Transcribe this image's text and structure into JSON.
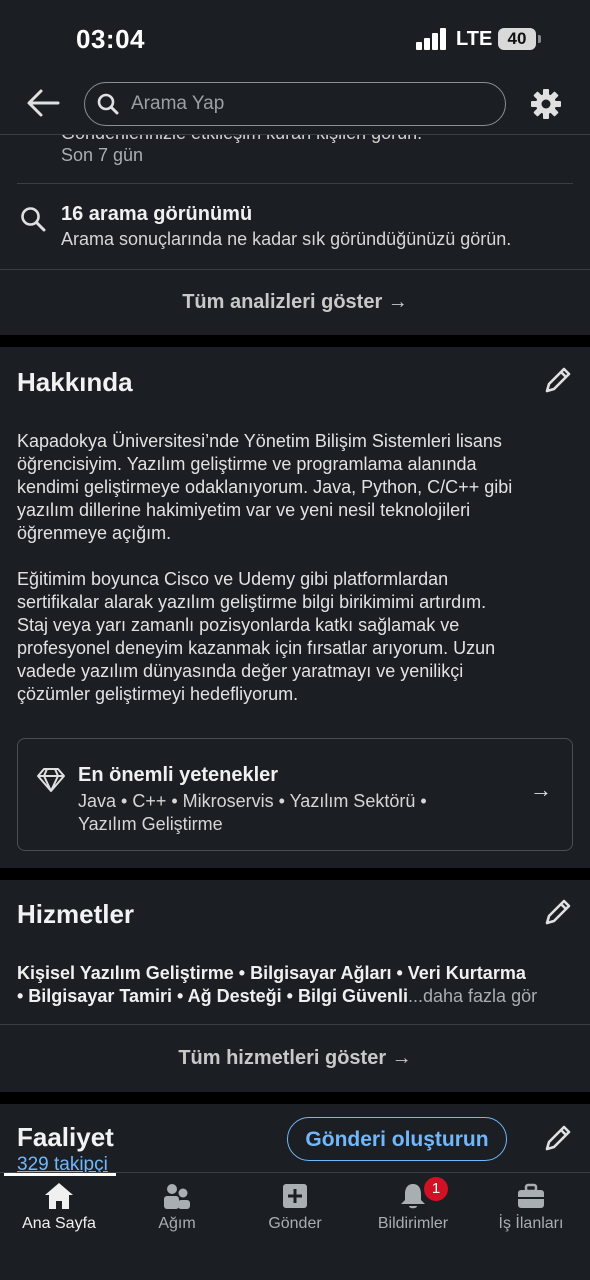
{
  "status_bar": {
    "time": "03:04",
    "network": "LTE",
    "battery": "40"
  },
  "top_bar": {
    "search_placeholder": "Arama Yap"
  },
  "analytics": {
    "partial_text": "Gönderilerinizle etkileşim kuran kişileri görün.",
    "period": "Son 7 gün",
    "search_appearances_title": "16 arama görünümü",
    "search_appearances_desc": "Arama sonuçlarında ne kadar sık göründüğünüzü görün.",
    "show_all": "Tüm analizleri göster →"
  },
  "about": {
    "title": "Hakkında",
    "paragraph1_lines": [
      "Kapadokya Üniversitesi’nde Yönetim Bilişim Sistemleri lisans",
      "öğrencisiyim. Yazılım geliştirme ve programlama alanında",
      "kendimi geliştirmeye odaklanıyorum. Java, Python, C/C++ gibi",
      "yazılım dillerine hakimiyetim var ve yeni nesil teknolojileri",
      "öğrenmeye açığım."
    ],
    "paragraph2_lines": [
      "Eğitimim boyunca Cisco ve Udemy gibi platformlardan",
      "sertifikalar alarak yazılım geliştirme bilgi birikimimi artırdım.",
      "Staj veya yarı zamanlı pozisyonlarda katkı sağlamak ve",
      "profesyonel deneyim kazanmak için fırsatlar arıyorum. Uzun",
      "vadede yazılım dünyasında değer yaratmayı ve yenilikçi",
      "çözümler geliştirmeyi hedefliyorum."
    ],
    "top_skills": {
      "title": "En önemli yetenekler",
      "line1": "Java • C++ • Mikroservis • Yazılım Sektörü •",
      "line2": "Yazılım Geliştirme",
      "arrow": "→"
    }
  },
  "services": {
    "title": "Hizmetler",
    "line1": "Kişisel Yazılım Geliştirme • Bilgisayar Ağları • Veri Kurtarma",
    "line2": "• Bilgisayar Tamiri • Ağ Desteği • Bilgi Güvenli",
    "more": "...daha fazla gör",
    "show_all": "Tüm hizmetleri göster →"
  },
  "activity": {
    "title": "Faaliyet",
    "create_post": "Gönderi oluşturun",
    "followers": "329 takipçi"
  },
  "bottom_nav": [
    {
      "label": "Ana Sayfa",
      "icon": "home-icon"
    },
    {
      "label": "Ağım",
      "icon": "network-icon"
    },
    {
      "label": "Gönder",
      "icon": "post-icon"
    },
    {
      "label": "Bildirimler",
      "icon": "bell-icon",
      "badge": "1"
    },
    {
      "label": "İş İlanları",
      "icon": "briefcase-icon"
    }
  ],
  "colors": {
    "background": "#1b1f23",
    "accent": "#71b7fb",
    "badge": "#d11124",
    "separator": "#000000"
  }
}
